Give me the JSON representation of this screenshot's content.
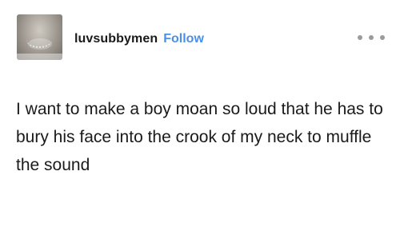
{
  "post": {
    "username": "luvsubbymen",
    "follow_label": "Follow",
    "more_icon": "more-horizontal-icon",
    "body": "I want to make a boy moan so loud that he has to bury his face into the crook of my neck to muffle the sound"
  },
  "colors": {
    "follow": "#4a8fe8",
    "text": "#1a1a1a",
    "menu_dots": "#9b9b9b",
    "background": "#ffffff"
  }
}
